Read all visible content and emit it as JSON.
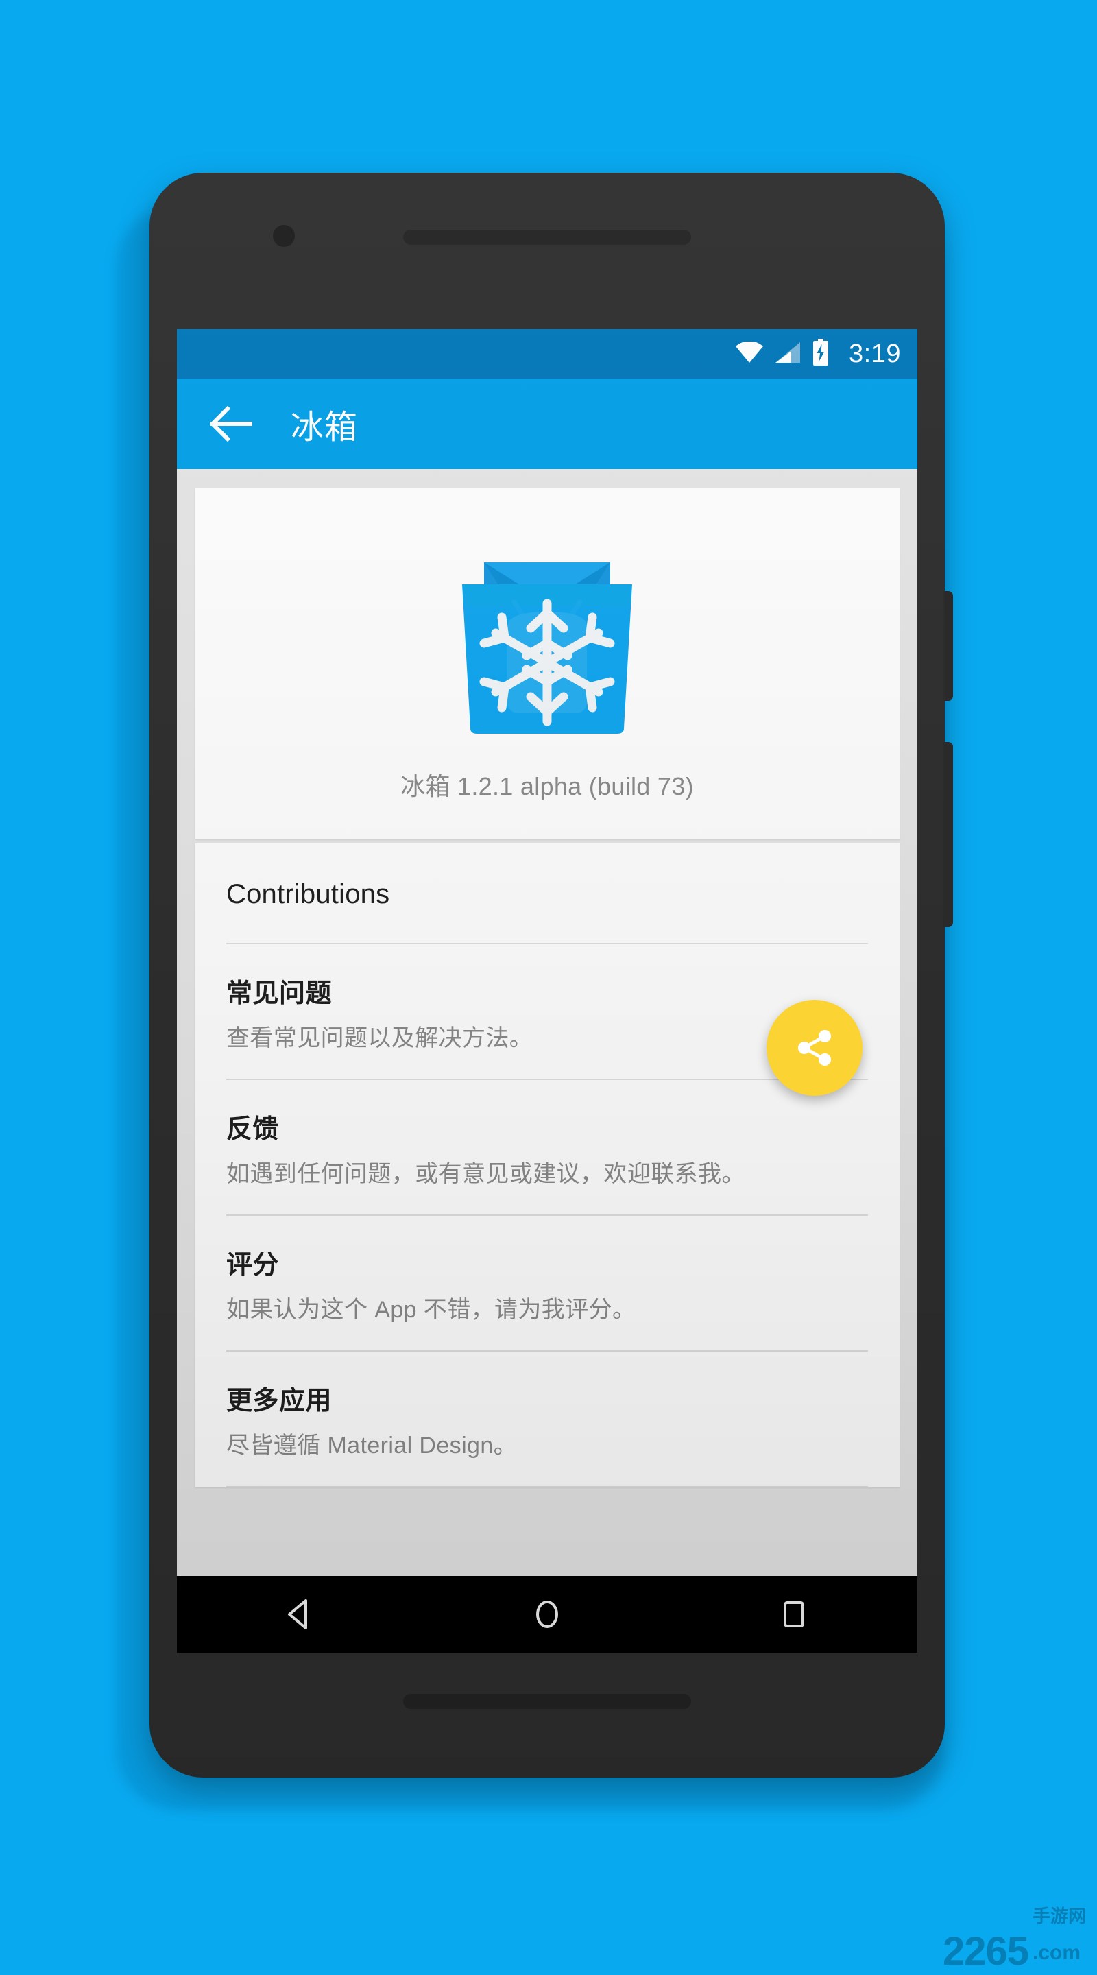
{
  "status_bar": {
    "time": "3:19",
    "wifi_icon": "wifi-icon",
    "signal_icon": "cellular-signal-icon",
    "battery_icon": "battery-charging-icon"
  },
  "app_bar": {
    "back_icon": "back-arrow-icon",
    "title": "冰箱"
  },
  "header_card": {
    "app_icon": "freezer-bag-snowflake-icon",
    "version": "冰箱 1.2.1 alpha (build 73)"
  },
  "fab": {
    "icon": "share-icon",
    "color": "#fbd434"
  },
  "list": {
    "section_header": "Contributions",
    "items": [
      {
        "title": "常见问题",
        "subtitle": "查看常见问题以及解决方法。"
      },
      {
        "title": "反馈",
        "subtitle": "如遇到任何问题，或有意见或建议，欢迎联系我。"
      },
      {
        "title": "评分",
        "subtitle": "如果认为这个 App 不错，请为我评分。"
      },
      {
        "title": "更多应用",
        "subtitle": "尽皆遵循 Material Design。"
      }
    ]
  },
  "nav_bar": {
    "back_key": "nav-back-icon",
    "home_key": "nav-home-icon",
    "recents_key": "nav-recents-icon"
  },
  "watermark": {
    "main": "2265",
    "cn": "手游网",
    "dotcom": ".com"
  },
  "colors": {
    "page_background": "#09a9f0",
    "status_bar": "#0277b9",
    "app_bar": "#03a0e8",
    "accent": "#fbd434",
    "content_background": "#e6e6e6"
  }
}
